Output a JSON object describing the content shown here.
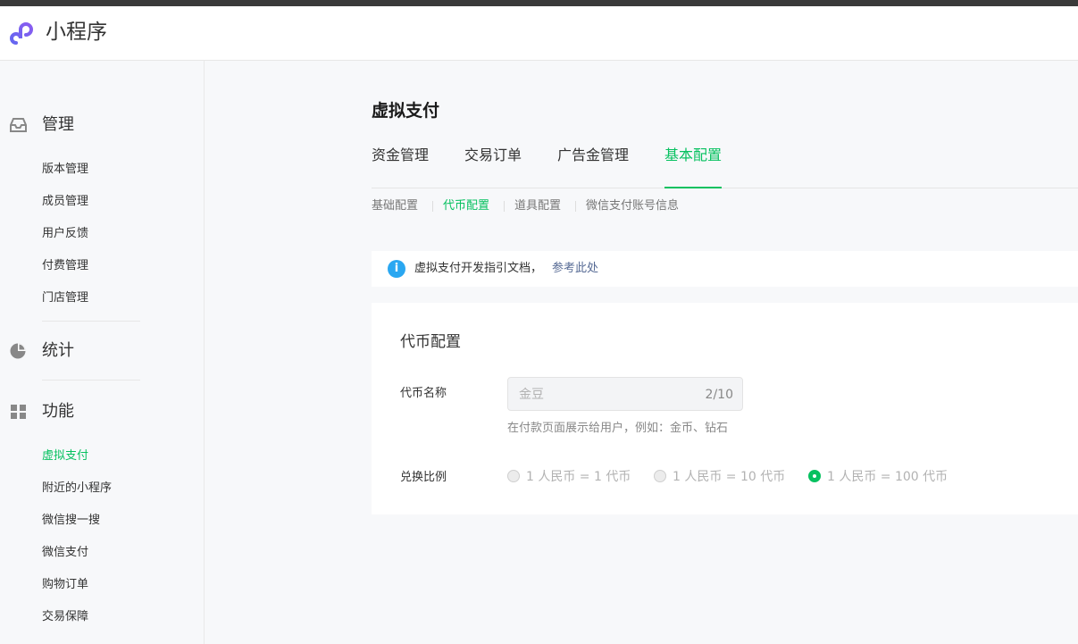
{
  "app": {
    "title": "小程序"
  },
  "sidebar": {
    "sections": [
      {
        "label": "管理",
        "icon": "inbox-icon",
        "items": [
          "版本管理",
          "成员管理",
          "用户反馈",
          "付费管理",
          "门店管理"
        ]
      },
      {
        "label": "统计",
        "icon": "pie-chart-icon",
        "items": []
      },
      {
        "label": "功能",
        "icon": "grid-icon",
        "items": [
          "虚拟支付",
          "附近的小程序",
          "微信搜一搜",
          "微信支付",
          "购物订单",
          "交易保障"
        ]
      }
    ],
    "active_item": "虚拟支付"
  },
  "page": {
    "title": "虚拟支付",
    "tabs": [
      "资金管理",
      "交易订单",
      "广告金管理",
      "基本配置"
    ],
    "active_tab": "基本配置",
    "subtabs": [
      "基础配置",
      "代币配置",
      "道具配置",
      "微信支付账号信息"
    ],
    "active_subtab": "代币配置"
  },
  "notice": {
    "text": "虚拟支付开发指引文档，",
    "link": "参考此处",
    "icon": "info-icon"
  },
  "card": {
    "title": "代币配置",
    "name_label": "代币名称",
    "name_value": "金豆",
    "name_count": "2/10",
    "name_hint": "在付款页面展示给用户，例如：金币、钻石",
    "ratio_label": "兑换比例",
    "ratio_options": [
      "1 人民币 = 1 代币",
      "1 人民币 = 10 代币",
      "1 人民币 = 100 代币"
    ],
    "ratio_selected": "1 人民币 = 100 代币"
  },
  "colors": {
    "accent": "#07c160",
    "info": "#2aa7f1",
    "link": "#576b95"
  }
}
